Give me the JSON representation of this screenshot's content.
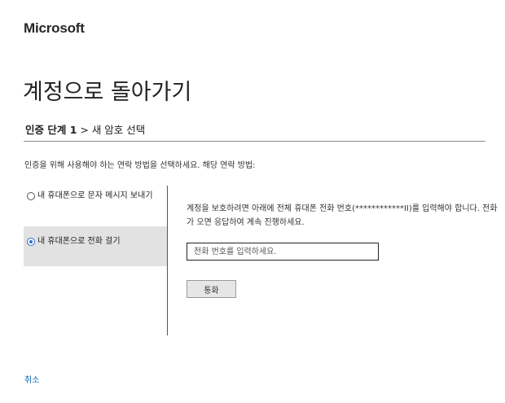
{
  "brand": "Microsoft",
  "title": "계정으로 돌아가기",
  "step": {
    "current": "인증 단계 1",
    "separator": " > ",
    "next": "새 암호 선택"
  },
  "instruction": "인증을 위해 사용해야 하는 연락 방법을 선택하세요. 해당 연락 방법:",
  "methods": [
    {
      "label": "내 휴대폰으로 문자 메시지 보내기",
      "selected": false
    },
    {
      "label": "내 휴대폰으로 전화 걸기",
      "selected": true
    }
  ],
  "description": "계정을 보호하려면 아래에 전체 휴대폰 전화 번호(************II)를 입력해야 합니다. 전화가 오면 응답하여 계속 진행하세요.",
  "phone_input": {
    "placeholder": "전화 번호를 입력하세요.",
    "value": ""
  },
  "call_button": "통화",
  "cancel_link": "취소",
  "colors": {
    "link": "#0067b8",
    "selected_bg": "#e2e2e2",
    "radio_accent": "#2b6fd6"
  }
}
